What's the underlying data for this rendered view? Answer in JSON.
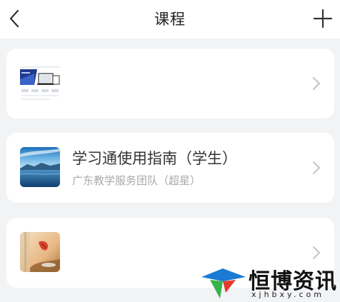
{
  "header": {
    "title": "课程"
  },
  "courses": [
    {
      "title": "",
      "subtitle": ""
    },
    {
      "title": "学习通使用指南（学生）",
      "subtitle": "广东教学服务团队（超星）"
    },
    {
      "title": "",
      "subtitle": ""
    }
  ],
  "watermark": {
    "brand": "恒博资讯",
    "url": "xjhbxy.com"
  },
  "colors": {
    "background": "#f2f3f5",
    "card": "#ffffff",
    "title_text": "#333333",
    "subtitle_text": "#a9a9a9",
    "chevron": "#c4c4c4"
  },
  "icons": {
    "back": "chevron-left-icon",
    "add": "plus-icon",
    "row_arrow": "chevron-right-icon"
  }
}
